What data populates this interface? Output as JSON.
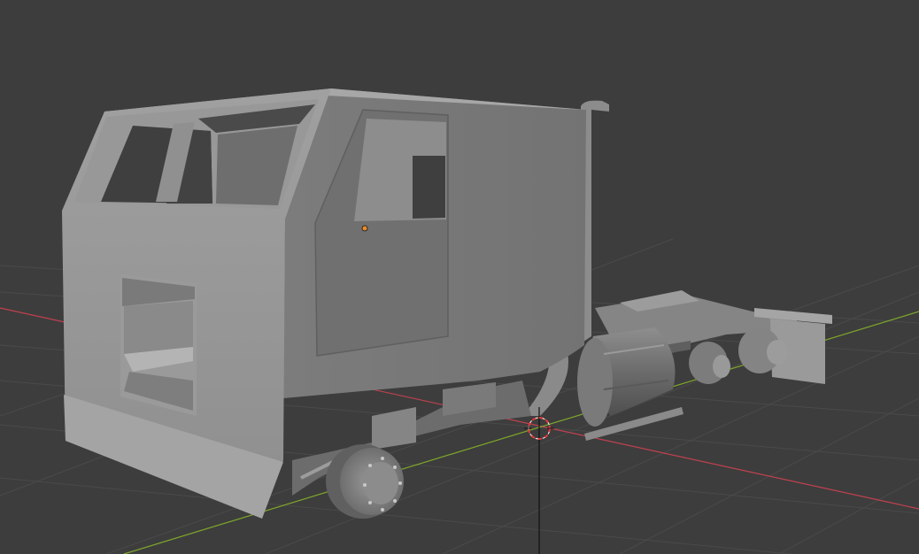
{
  "viewport": {
    "mode": "3d-viewport",
    "shading": "solid",
    "background_color": "#3d3d3d",
    "grid_color": "#4a4a4a",
    "x_axis_color": "#c2414f",
    "y_axis_color": "#7fa82a",
    "mesh_color": "#8f8f8f",
    "origin_color": "#f08a24",
    "cursor_color": "#e03a3a",
    "object": "truck-cab-and-chassis"
  }
}
